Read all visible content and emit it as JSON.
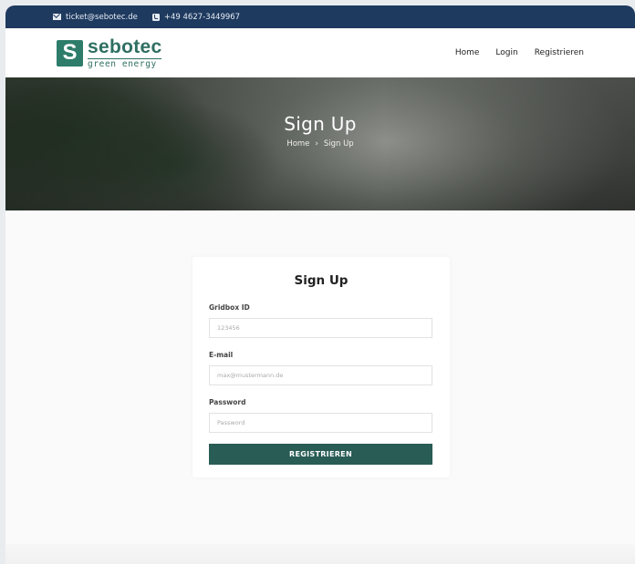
{
  "topbar": {
    "email": "ticket@sebotec.de",
    "phone": "+49 4627-3449967"
  },
  "logo": {
    "mark": "S",
    "name": "sebotec",
    "tagline": "green energy"
  },
  "nav": {
    "items": [
      {
        "label": "Home"
      },
      {
        "label": "Login"
      },
      {
        "label": "Registrieren"
      }
    ]
  },
  "hero": {
    "title": "Sign Up",
    "breadcrumb": [
      "Home",
      "›",
      "Sign Up"
    ]
  },
  "form": {
    "title": "Sign Up",
    "fields": [
      {
        "label": "Gridbox ID",
        "placeholder": "123456"
      },
      {
        "label": "E-mail",
        "placeholder": "max@mustermann.de"
      },
      {
        "label": "Password",
        "placeholder": "Password"
      }
    ],
    "submit_label": "REGISTRIEREN"
  },
  "colors": {
    "topbar": "#1f3a5f",
    "brand": "#2e7d6b",
    "button": "#285c55"
  }
}
